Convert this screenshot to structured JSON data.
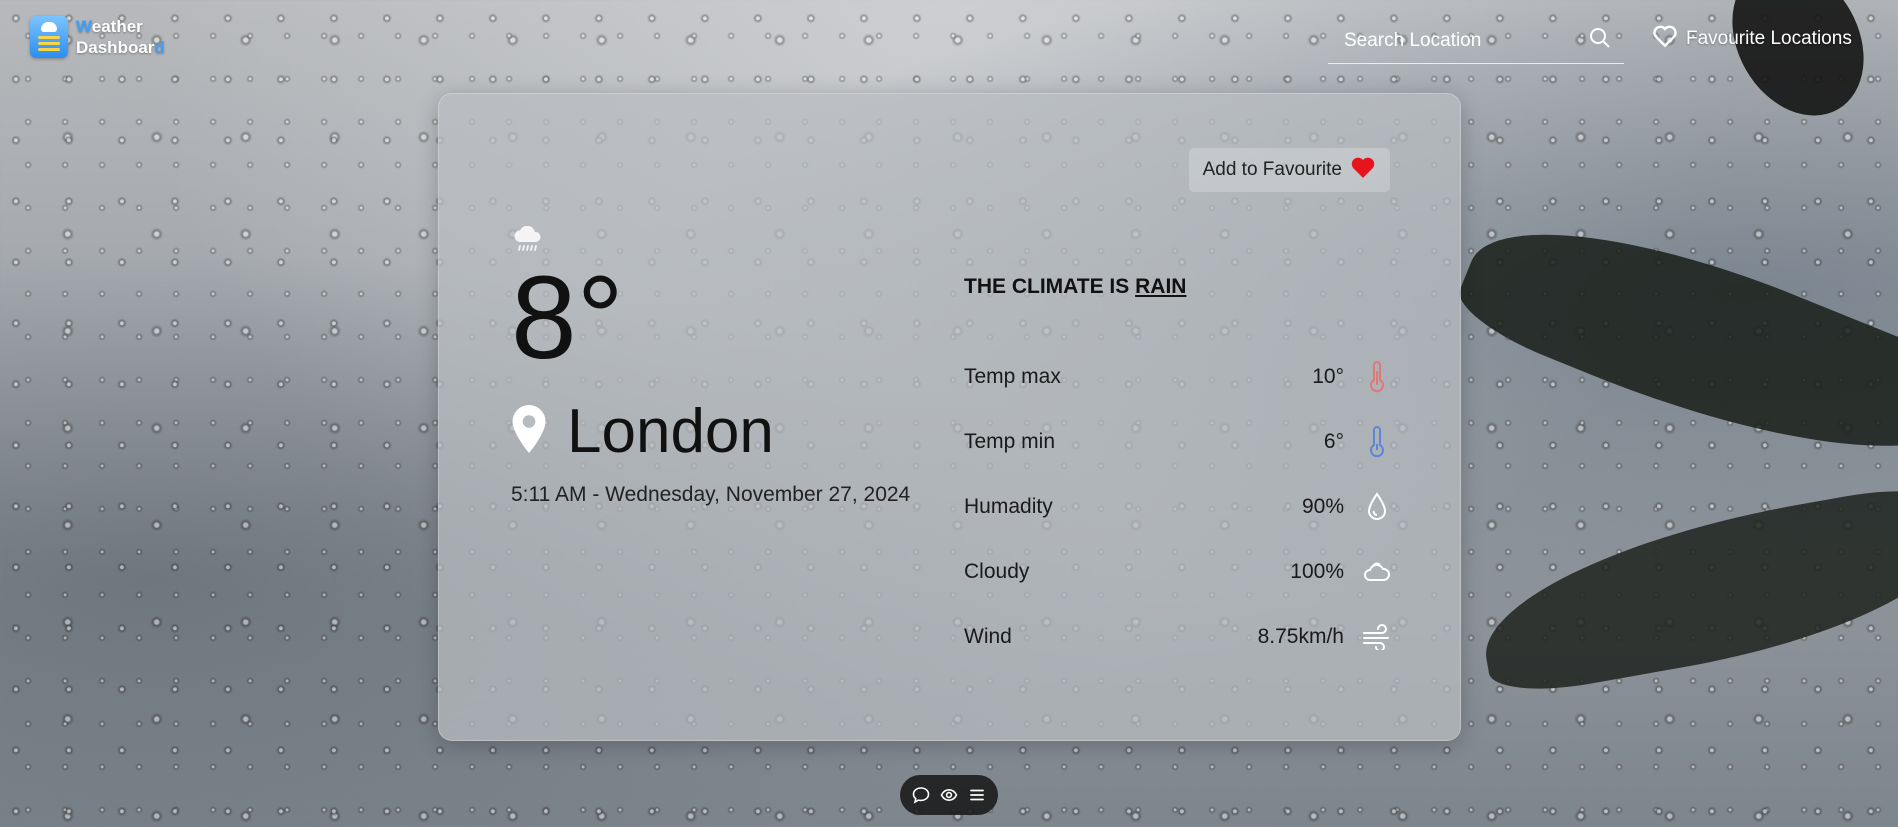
{
  "brand": {
    "line1_first": "W",
    "line1_rest": "eather",
    "line2_main": "Dashboar",
    "line2_last": "d"
  },
  "header": {
    "search_placeholder": "Search Location",
    "favourites_label": "Favourite Locations"
  },
  "card": {
    "add_favourite_label": "Add to Favourite",
    "weather_icon": "rain-cloud-icon",
    "temperature": "8°",
    "city": "London",
    "datetime": "5:11 AM - Wednesday, November 27, 2024",
    "climate_prefix": "THE CLIMATE IS",
    "climate_condition": "RAIN",
    "stats": [
      {
        "label": "Temp max",
        "value": "10°",
        "icon": "thermometer-hot-icon"
      },
      {
        "label": "Temp min",
        "value": "6°",
        "icon": "thermometer-cold-icon"
      },
      {
        "label": "Humadity",
        "value": "90%",
        "icon": "droplet-icon"
      },
      {
        "label": "Cloudy",
        "value": "100%",
        "icon": "cloud-icon"
      },
      {
        "label": "Wind",
        "value": "8.75km/h",
        "icon": "wind-icon"
      }
    ]
  },
  "toolbar": {
    "icons": [
      "comment-icon",
      "eye-icon",
      "menu-icon"
    ]
  },
  "colors": {
    "accent": "#3aa0ff",
    "heart": "#e8141b",
    "hot": "#e07878",
    "cold": "#5d86d8"
  }
}
